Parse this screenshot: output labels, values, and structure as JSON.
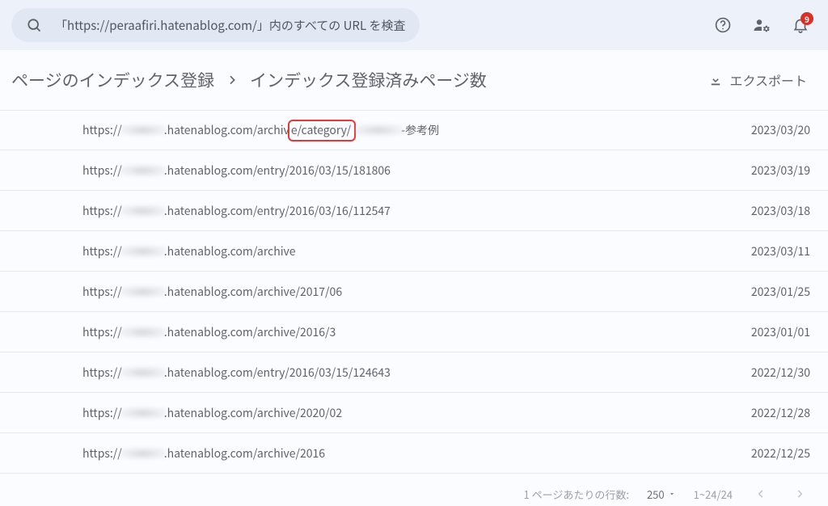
{
  "search": {
    "placeholder": "「https://peraafiri.hatenablog.com/」内のすべての URL を検査"
  },
  "notifications": {
    "count": "9"
  },
  "breadcrumb": {
    "parent": "ページのインデックス登録",
    "current": "インデックス登録済みページ数"
  },
  "export_label": "エクスポート",
  "rows": [
    {
      "pre": "https://",
      "mid": ".hatenablog.com/archiv",
      "hl": "e/category/",
      "suffix2": "-参考例",
      "date": "2023/03/20",
      "highlighted": true
    },
    {
      "pre": "https://",
      "mid": ".hatenablog.com/entry/2016/03/15/181806",
      "date": "2023/03/19"
    },
    {
      "pre": "https://",
      "mid": ".hatenablog.com/entry/2016/03/16/112547",
      "date": "2023/03/18"
    },
    {
      "pre": "https://",
      "mid": ".hatenablog.com/archive",
      "date": "2023/03/11"
    },
    {
      "pre": "https://",
      "mid": ".hatenablog.com/archive/2017/06",
      "date": "2023/01/25"
    },
    {
      "pre": "https://",
      "mid": ".hatenablog.com/archive/2016/3",
      "date": "2023/01/01"
    },
    {
      "pre": "https://",
      "mid": ".hatenablog.com/entry/2016/03/15/124643",
      "date": "2022/12/30"
    },
    {
      "pre": "https://",
      "mid": ".hatenablog.com/archive/2020/02",
      "date": "2022/12/28"
    },
    {
      "pre": "https://",
      "mid": ".hatenablog.com/archive/2016",
      "date": "2022/12/25"
    }
  ],
  "pager": {
    "rows_label": "1 ページあたりの行数:",
    "page_size": "250",
    "range": "1~24/24"
  }
}
